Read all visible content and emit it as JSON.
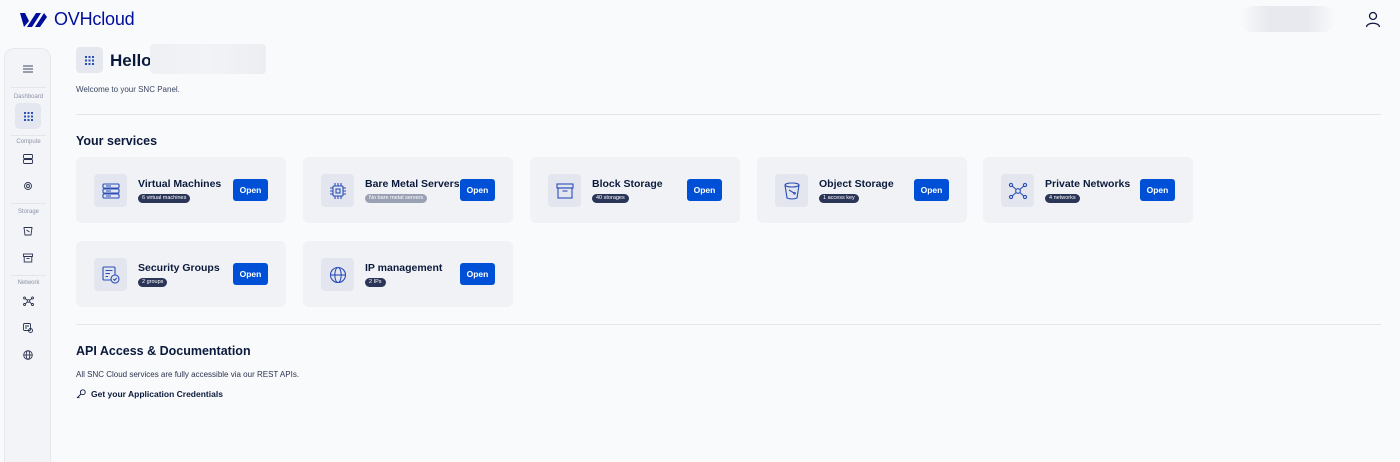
{
  "header": {
    "logo_text": "OVHcloud",
    "user_name_blurred": "",
    "icons": {
      "logo": "ovh-logo-icon",
      "user": "user-icon"
    }
  },
  "sidebar": {
    "menu_icon": "menu-icon",
    "groups": [
      {
        "label": "Dashboard",
        "items": [
          {
            "icon": "grid-icon",
            "active": true
          }
        ]
      },
      {
        "label": "Compute",
        "items": [
          {
            "icon": "server-icon"
          },
          {
            "icon": "chip-icon"
          }
        ]
      },
      {
        "label": "Storage",
        "items": [
          {
            "icon": "bucket-icon"
          },
          {
            "icon": "archive-icon"
          }
        ]
      },
      {
        "label": "Network",
        "items": [
          {
            "icon": "network-icon"
          },
          {
            "icon": "security-group-icon"
          },
          {
            "icon": "globe-icon"
          }
        ]
      }
    ]
  },
  "greeting": {
    "hello": "Hello,",
    "welcome": "Welcome to your SNC Panel."
  },
  "services": {
    "title": "Your services",
    "cards": [
      {
        "name": "Virtual Machines",
        "badge": "6 virtual machines",
        "icon": "server-icon",
        "open_label": "Open"
      },
      {
        "name": "Bare Metal Servers",
        "badge": "No bare metal servers",
        "icon": "chip-icon",
        "open_label": "Open",
        "muted": true
      },
      {
        "name": "Block Storage",
        "badge": "40 storages",
        "icon": "archive-icon",
        "open_label": "Open"
      },
      {
        "name": "Object Storage",
        "badge": "1 access key",
        "icon": "bucket-icon",
        "open_label": "Open"
      },
      {
        "name": "Private Networks",
        "badge": "4 networks",
        "icon": "network-icon",
        "open_label": "Open"
      },
      {
        "name": "Security Groups",
        "badge": "2 groups",
        "icon": "security-group-icon",
        "open_label": "Open"
      },
      {
        "name": "IP management",
        "badge": "2 IPs",
        "icon": "globe-icon",
        "open_label": "Open"
      }
    ]
  },
  "api": {
    "title": "API Access & Documentation",
    "description": "All SNC Cloud services are fully accessible via our REST APIs.",
    "credentials_link": "Get your Application Credentials",
    "icon": "key-icon"
  },
  "colors": {
    "accent": "#0050d7",
    "brand": "#000e9c",
    "text": "#0b1a3c",
    "badge": "#2a3557"
  }
}
